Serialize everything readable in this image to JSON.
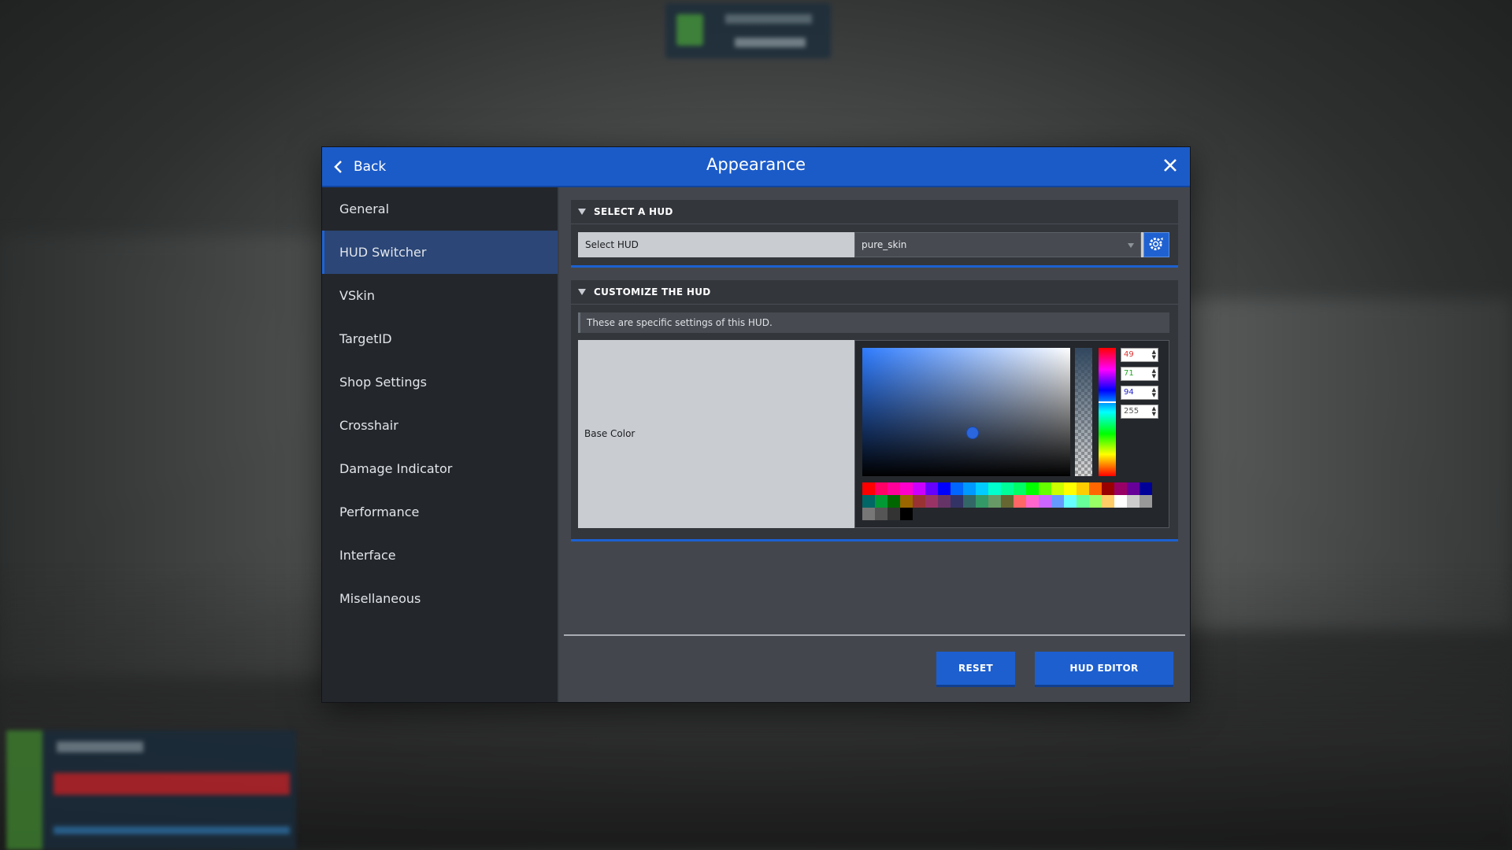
{
  "header": {
    "back_label": "Back",
    "title": "Appearance",
    "back_icon": "chevron-left-icon",
    "close_icon": "close-icon"
  },
  "sidebar": {
    "items": [
      {
        "label": "General",
        "active": false
      },
      {
        "label": "HUD Switcher",
        "active": true
      },
      {
        "label": "VSkin",
        "active": false
      },
      {
        "label": "TargetID",
        "active": false
      },
      {
        "label": "Shop Settings",
        "active": false
      },
      {
        "label": "Crosshair",
        "active": false
      },
      {
        "label": "Damage Indicator",
        "active": false
      },
      {
        "label": "Performance",
        "active": false
      },
      {
        "label": "Interface",
        "active": false
      },
      {
        "label": "Misellaneous",
        "active": false
      }
    ]
  },
  "select_hud": {
    "section_title": "SELECT A HUD",
    "row_label": "Select HUD",
    "selected_value": "pure_skin",
    "settings_icon": "gear-refresh-icon"
  },
  "customize": {
    "section_title": "CUSTOMIZE THE HUD",
    "description": "These are specific settings of this HUD.",
    "color_label": "Base Color",
    "rgba": {
      "r": "49",
      "g": "71",
      "b": "94",
      "a": "255"
    }
  },
  "palette": [
    "#ff0000",
    "#ff0066",
    "#ff0099",
    "#ff00cc",
    "#cc00ff",
    "#6600ff",
    "#0000ff",
    "#0066ff",
    "#0099ff",
    "#00ccff",
    "#00ffcc",
    "#00ff99",
    "#00ff66",
    "#00ff00",
    "#66ff00",
    "#ccff00",
    "#ffff00",
    "#ffcc00",
    "#ff6600",
    "#990000",
    "#990066",
    "#660099",
    "#000099",
    "#006666",
    "#009933",
    "#006600",
    "#996600",
    "#993333",
    "#993366",
    "#663366",
    "#333366",
    "#336666",
    "#339966",
    "#669966",
    "#666633",
    "#ff6666",
    "#ff66cc",
    "#cc66ff",
    "#6699ff",
    "#66ffff",
    "#66ff99",
    "#99ff66",
    "#ffcc66",
    "#ffffff",
    "#cccccc",
    "#999999",
    "#777777",
    "#555555",
    "#333333",
    "#000000"
  ],
  "footer": {
    "reset_label": "RESET",
    "editor_label": "HUD EDITOR"
  },
  "colors": {
    "accent": "#1b5bc8",
    "sidebar_active": "#2b4677",
    "panel_bg": "#43474d"
  }
}
